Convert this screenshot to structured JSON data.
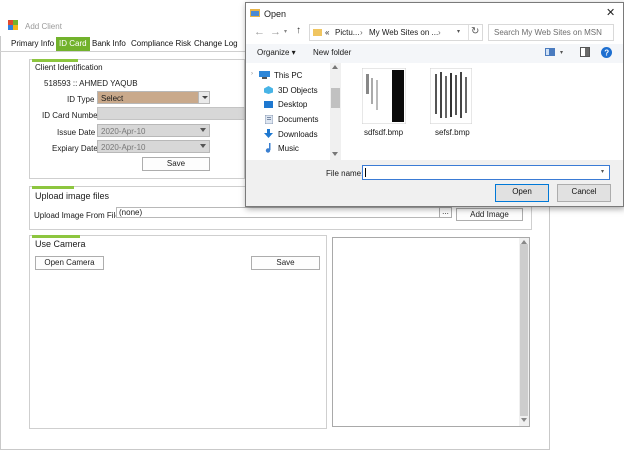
{
  "window": {
    "title": "Add Client"
  },
  "tabs": [
    "Primary Info",
    "ID Card",
    "Bank Info",
    "Compliance Risk",
    "Change Log"
  ],
  "identification": {
    "group_title": "Client Identification",
    "client_line": "518593 :: AHMED YAQUB",
    "id_type_label": "ID Type",
    "id_type_value": "Select",
    "id_number_label": "ID Card Number",
    "issue_label": "Issue Date",
    "issue_value": "2020-Apr-10",
    "expiry_label": "Expiary Date",
    "expiry_value": "2020-Apr-10",
    "save_label": "Save"
  },
  "upload": {
    "group_title": "Upload image files",
    "from_file_label": "Upload Image From File",
    "field_value": "(none)",
    "browse_label": "...",
    "add_label": "Add Image"
  },
  "camera": {
    "group_title": "Use Camera",
    "open_label": "Open Camera",
    "save_label": "Save"
  },
  "dialog": {
    "title": "Open",
    "close_glyph": "✕",
    "breadcrumb": [
      "«",
      "Pictu...",
      "›",
      "My Web Sites on ...",
      "›"
    ],
    "search_placeholder": "Search My Web Sites on MSN",
    "organize_label": "Organize ▾",
    "new_folder_label": "New folder",
    "nav_items": [
      "This PC",
      "3D Objects",
      "Desktop",
      "Documents",
      "Downloads",
      "Music"
    ],
    "files": [
      {
        "name": "sdfsdf.bmp"
      },
      {
        "name": "sefsf.bmp"
      }
    ],
    "file_name_label": "File name:",
    "file_name_value": "",
    "open_label": "Open",
    "cancel_label": "Cancel"
  },
  "colors": {
    "accent_green": "#72b22c",
    "tab_bar_green": "#8dc63f",
    "id_type_combo": "#c9a98b",
    "dialog_primary": "#0078d7"
  }
}
